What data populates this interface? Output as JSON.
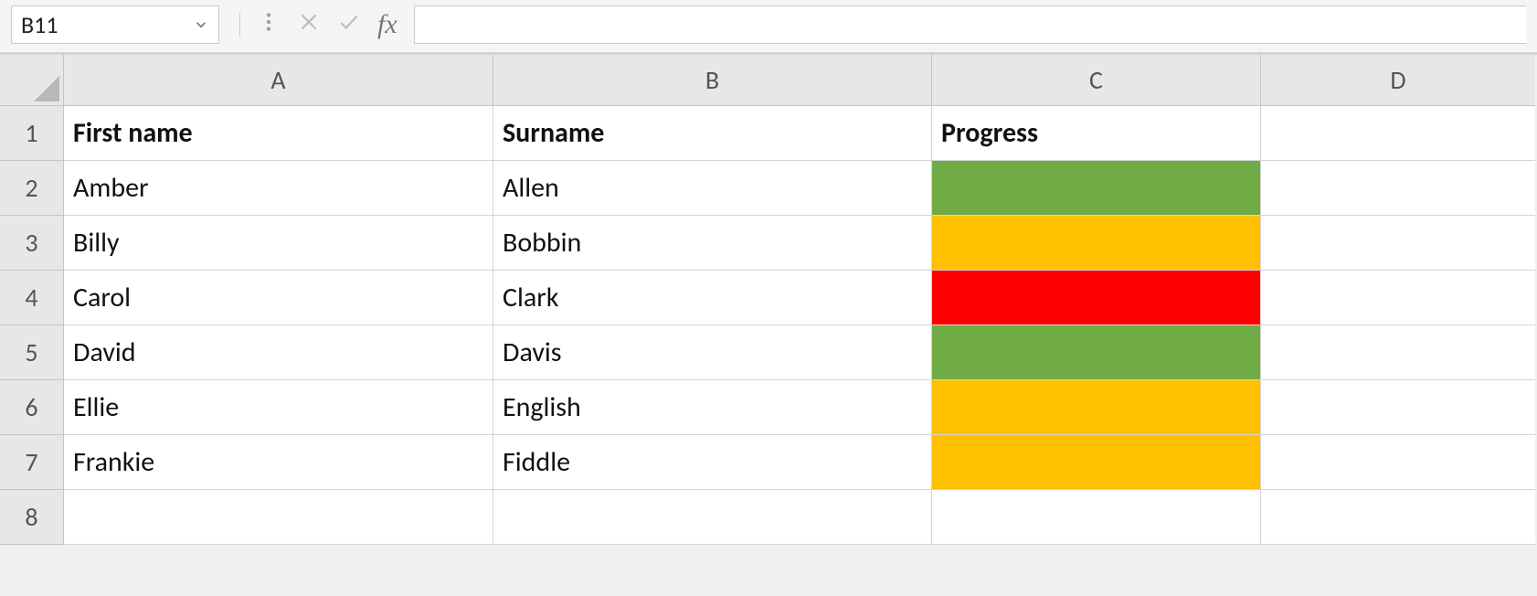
{
  "formula_bar": {
    "name_box_value": "B11",
    "fx_label": "fx",
    "formula_value": ""
  },
  "columns": [
    "A",
    "B",
    "C",
    "D"
  ],
  "row_numbers": [
    "1",
    "2",
    "3",
    "4",
    "5",
    "6",
    "7",
    "8"
  ],
  "headers": {
    "a": "First name",
    "b": "Surname",
    "c": "Progress"
  },
  "data_rows": [
    {
      "first": "Amber",
      "last": "Allen",
      "progress": "green"
    },
    {
      "first": "Billy",
      "last": "Bobbin",
      "progress": "amber"
    },
    {
      "first": "Carol",
      "last": "Clark",
      "progress": "red"
    },
    {
      "first": "David",
      "last": "Davis",
      "progress": "green"
    },
    {
      "first": "Ellie",
      "last": "English",
      "progress": "amber"
    },
    {
      "first": "Frankie",
      "last": "Fiddle",
      "progress": "amber"
    }
  ],
  "colors": {
    "green": "#6fac46",
    "amber": "#ffc000",
    "red": "#ff0000"
  }
}
